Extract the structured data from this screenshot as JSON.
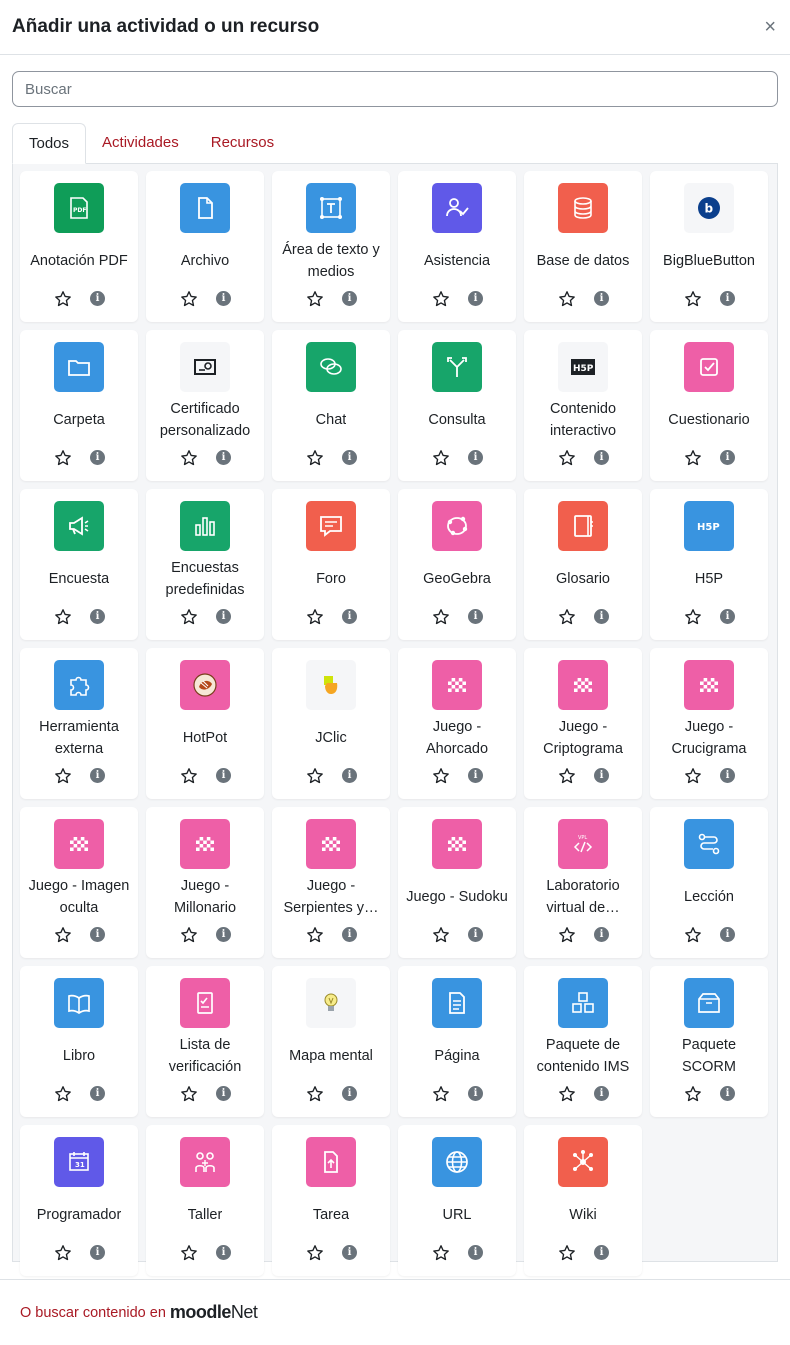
{
  "header": {
    "title": "Añadir una actividad o un recurso",
    "close_symbol": "×"
  },
  "search": {
    "placeholder": "Buscar",
    "value": ""
  },
  "tabs": [
    {
      "label": "Todos",
      "active": true
    },
    {
      "label": "Actividades",
      "active": false
    },
    {
      "label": "Recursos",
      "active": false
    }
  ],
  "modules": [
    {
      "name": "Anotación PDF",
      "color": "#0f9d58",
      "icon": "pdf-icon"
    },
    {
      "name": "Archivo",
      "color": "#3994e0",
      "icon": "file-icon"
    },
    {
      "name": "Área de texto y medios",
      "color": "#3994e0",
      "icon": "textarea-icon"
    },
    {
      "name": "Asistencia",
      "color": "#6059e8",
      "icon": "attendance-icon"
    },
    {
      "name": "Base de datos",
      "color": "#f15f4d",
      "icon": "database-icon"
    },
    {
      "name": "BigBlueButton",
      "color": "#f5f6f8",
      "icon": "bigbluebutton-icon"
    },
    {
      "name": "Carpeta",
      "color": "#3994e0",
      "icon": "folder-icon"
    },
    {
      "name": "Certificado personalizado",
      "color": "#f5f6f8",
      "icon": "certificate-icon"
    },
    {
      "name": "Chat",
      "color": "#17a56a",
      "icon": "chat-icon"
    },
    {
      "name": "Consulta",
      "color": "#17a56a",
      "icon": "choice-icon"
    },
    {
      "name": "Contenido interactivo",
      "color": "#f5f6f8",
      "icon": "h5p-dark-icon"
    },
    {
      "name": "Cuestionario",
      "color": "#ee5fa7",
      "icon": "quiz-icon"
    },
    {
      "name": "Encuesta",
      "color": "#17a56a",
      "icon": "feedback-icon"
    },
    {
      "name": "Encuestas predefinidas",
      "color": "#17a56a",
      "icon": "survey-icon"
    },
    {
      "name": "Foro",
      "color": "#f15f4d",
      "icon": "forum-icon"
    },
    {
      "name": "GeoGebra",
      "color": "#ee5fa7",
      "icon": "geogebra-icon"
    },
    {
      "name": "Glosario",
      "color": "#f15f4d",
      "icon": "glossary-icon"
    },
    {
      "name": "H5P",
      "color": "#3994e0",
      "icon": "h5p-icon"
    },
    {
      "name": "Herramienta externa",
      "color": "#3994e0",
      "icon": "puzzle-icon"
    },
    {
      "name": "HotPot",
      "color": "#ee5fa7",
      "icon": "hotpot-icon"
    },
    {
      "name": "JClic",
      "color": "#f5f6f8",
      "icon": "jclic-icon"
    },
    {
      "name": "Juego - Ahorcado",
      "color": "#ee5fa7",
      "icon": "game-icon"
    },
    {
      "name": "Juego - Criptograma",
      "color": "#ee5fa7",
      "icon": "game-icon"
    },
    {
      "name": "Juego - Crucigrama",
      "color": "#ee5fa7",
      "icon": "game-icon"
    },
    {
      "name": "Juego - Imagen oculta",
      "color": "#ee5fa7",
      "icon": "game-icon"
    },
    {
      "name": "Juego - Millonario",
      "color": "#ee5fa7",
      "icon": "game-icon"
    },
    {
      "name": "Juego - Serpientes y…",
      "color": "#ee5fa7",
      "icon": "game-icon"
    },
    {
      "name": "Juego - Sudoku",
      "color": "#ee5fa7",
      "icon": "game-icon"
    },
    {
      "name": "Laboratorio virtual de…",
      "color": "#ee5fa7",
      "icon": "vpl-icon"
    },
    {
      "name": "Lección",
      "color": "#3994e0",
      "icon": "lesson-icon"
    },
    {
      "name": "Libro",
      "color": "#3994e0",
      "icon": "book-icon"
    },
    {
      "name": "Lista de verificación",
      "color": "#ee5fa7",
      "icon": "checklist-icon"
    },
    {
      "name": "Mapa mental",
      "color": "#f5f6f8",
      "icon": "lightbulb-icon"
    },
    {
      "name": "Página",
      "color": "#3994e0",
      "icon": "page-icon"
    },
    {
      "name": "Paquete de contenido IMS",
      "color": "#3994e0",
      "icon": "ims-icon"
    },
    {
      "name": "Paquete SCORM",
      "color": "#3994e0",
      "icon": "scorm-icon"
    },
    {
      "name": "Programador",
      "color": "#6059e8",
      "icon": "scheduler-icon"
    },
    {
      "name": "Taller",
      "color": "#ee5fa7",
      "icon": "workshop-icon"
    },
    {
      "name": "Tarea",
      "color": "#ee5fa7",
      "icon": "assignment-icon"
    },
    {
      "name": "URL",
      "color": "#3994e0",
      "icon": "globe-icon"
    },
    {
      "name": "Wiki",
      "color": "#f15f4d",
      "icon": "wiki-icon"
    }
  ],
  "footer": {
    "text": "O buscar contenido en",
    "brand_part1": "moodle",
    "brand_part2": "Net"
  }
}
